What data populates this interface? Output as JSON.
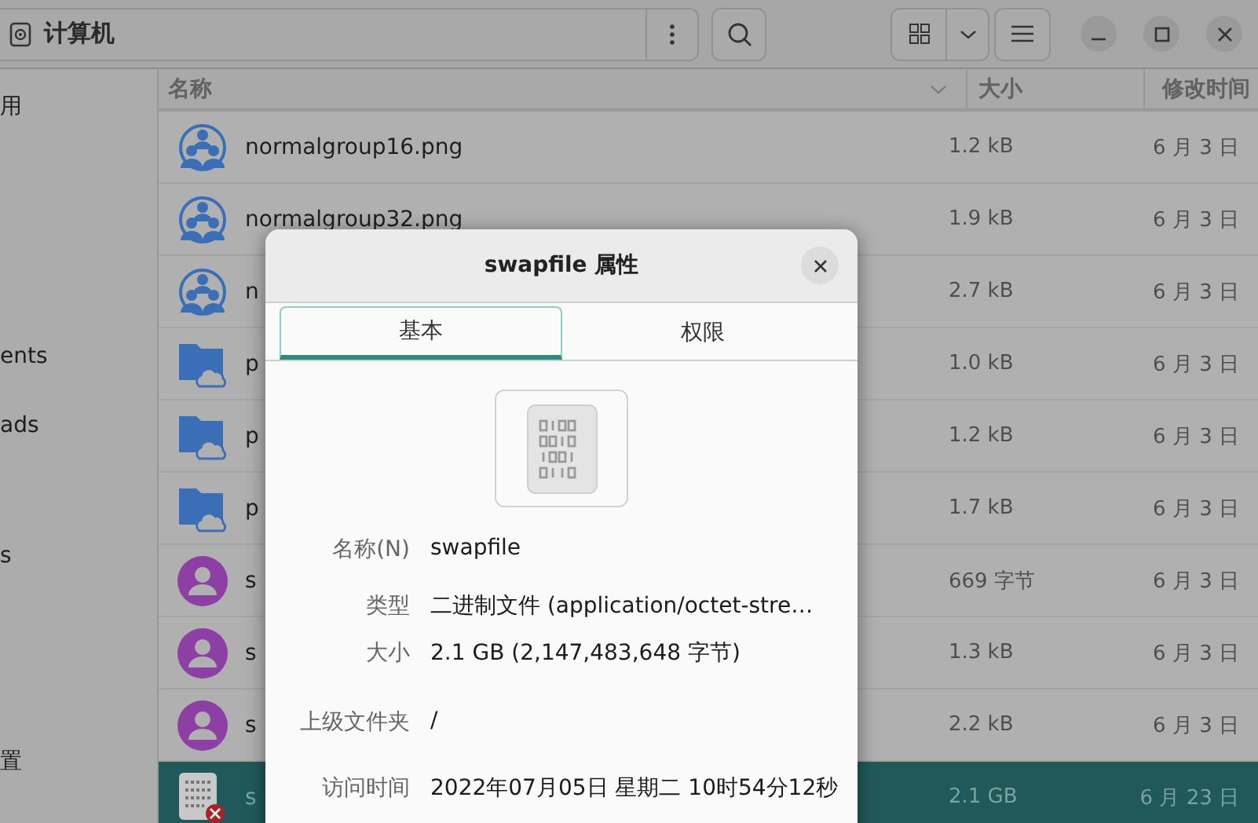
{
  "window": {
    "title": "计算机"
  },
  "sidebar": {
    "items": [
      {
        "label": "用"
      },
      {
        "label": "ents"
      },
      {
        "label": "ads"
      },
      {
        "label": "s"
      },
      {
        "label": "置"
      }
    ]
  },
  "table": {
    "columns": [
      "名称",
      "大小",
      "修改时间"
    ],
    "rows": [
      {
        "kind": "group",
        "name": "normalgroup16.png",
        "size": "1.2 kB",
        "modified": "6 月 3 日",
        "selected": false
      },
      {
        "kind": "group",
        "name": "normalgroup32.png",
        "size": "1.9 kB",
        "modified": "6 月 3 日",
        "selected": false
      },
      {
        "kind": "group",
        "name": "n",
        "size": "2.7 kB",
        "modified": "6 月 3 日",
        "selected": false
      },
      {
        "kind": "cloud-folder",
        "name": "p",
        "size": "1.0 kB",
        "modified": "6 月 3 日",
        "selected": false
      },
      {
        "kind": "cloud-folder",
        "name": "p",
        "size": "1.2 kB",
        "modified": "6 月 3 日",
        "selected": false
      },
      {
        "kind": "cloud-folder",
        "name": "p",
        "size": "1.7 kB",
        "modified": "6 月 3 日",
        "selected": false
      },
      {
        "kind": "user",
        "name": "s",
        "size": "669 字节",
        "modified": "6 月 3 日",
        "selected": false
      },
      {
        "kind": "user",
        "name": "s",
        "size": "1.3 kB",
        "modified": "6 月 3 日",
        "selected": false
      },
      {
        "kind": "user",
        "name": "s",
        "size": "2.2 kB",
        "modified": "6 月 3 日",
        "selected": false
      },
      {
        "kind": "binary",
        "name": "s",
        "size": "2.1 GB",
        "modified": "6 月 23 日",
        "selected": true
      }
    ]
  },
  "dialog": {
    "title": "swapfile 属性",
    "tabs": [
      {
        "label": "基本",
        "selected": true
      },
      {
        "label": "权限",
        "selected": false
      }
    ],
    "properties": [
      {
        "label": "名称(N)",
        "value": "swapfile"
      },
      {
        "label": "类型",
        "value": "二进制文件 (application/octet-stre…"
      },
      {
        "label": "大小",
        "value": "2.1 GB (2,147,483,648 字节)"
      },
      {
        "label": "上级文件夹",
        "value": "/"
      },
      {
        "label": "访问时间",
        "value": "2022年07月05日 星期二 10时54分12秒"
      }
    ]
  }
}
